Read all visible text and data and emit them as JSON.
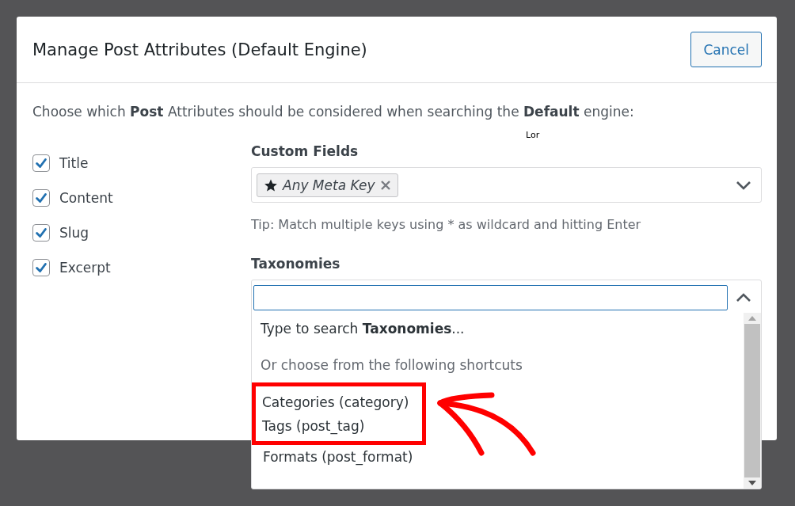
{
  "modal": {
    "title": "Manage Post Attributes (Default Engine)",
    "cancel_button": "Cancel",
    "description": "Choose which **Post** Attributes should be considered when searching the **Default** engine:",
    "attributes": [
      {
        "label": "Title",
        "checked": true
      },
      {
        "label": "Content",
        "checked": true
      },
      {
        "label": "Slug",
        "checked": true
      },
      {
        "label": "Excerpt",
        "checked": true
      }
    ],
    "custom_fields": {
      "label": "Custom Fields",
      "tags": [
        {
          "label": "Any Meta Key"
        }
      ],
      "tip": "Tip: Match multiple keys using * as wildcard and hitting Enter"
    },
    "stray_text": "Lor",
    "taxonomies": {
      "label": "Taxonomies",
      "expanded": true,
      "hint": "Type to search **Taxonomies**...",
      "shortcuts_heading": "Or choose from the following shortcuts",
      "options": [
        {
          "label": "Categories (category)",
          "highlighted": true
        },
        {
          "label": "Tags (post_tag)",
          "highlighted": true
        },
        {
          "label": "Formats (post_format)",
          "highlighted": false
        }
      ]
    }
  }
}
